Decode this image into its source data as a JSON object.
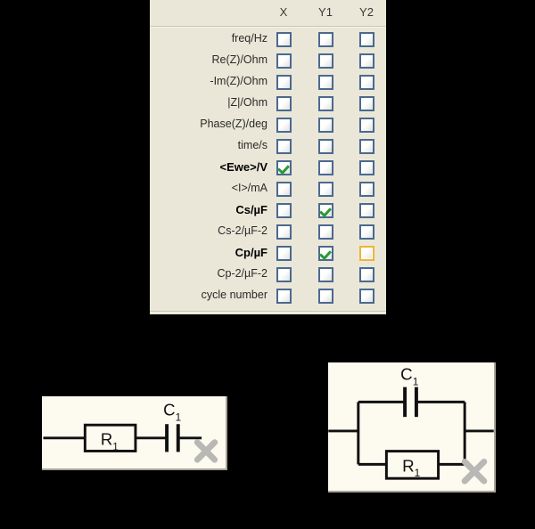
{
  "variable_panel": {
    "columns": [
      "X",
      "Y1",
      "Y2"
    ],
    "rows": [
      {
        "label": "freq/Hz",
        "bold": false,
        "x": false,
        "y1": false,
        "y2": false,
        "y2_focus": false
      },
      {
        "label": "Re(Z)/Ohm",
        "bold": false,
        "x": false,
        "y1": false,
        "y2": false,
        "y2_focus": false
      },
      {
        "label": "-Im(Z)/Ohm",
        "bold": false,
        "x": false,
        "y1": false,
        "y2": false,
        "y2_focus": false
      },
      {
        "label": "|Z|/Ohm",
        "bold": false,
        "x": false,
        "y1": false,
        "y2": false,
        "y2_focus": false
      },
      {
        "label": "Phase(Z)/deg",
        "bold": false,
        "x": false,
        "y1": false,
        "y2": false,
        "y2_focus": false
      },
      {
        "label": "time/s",
        "bold": false,
        "x": false,
        "y1": false,
        "y2": false,
        "y2_focus": false
      },
      {
        "label": "<Ewe>/V",
        "bold": true,
        "x": true,
        "y1": false,
        "y2": false,
        "y2_focus": false
      },
      {
        "label": "<I>/mA",
        "bold": false,
        "x": false,
        "y1": false,
        "y2": false,
        "y2_focus": false
      },
      {
        "label": "Cs/µF",
        "bold": true,
        "x": false,
        "y1": true,
        "y2": false,
        "y2_focus": false
      },
      {
        "label": "Cs-2/µF-2",
        "bold": false,
        "x": false,
        "y1": false,
        "y2": false,
        "y2_focus": false
      },
      {
        "label": "Cp/µF",
        "bold": true,
        "x": false,
        "y1": true,
        "y2": false,
        "y2_focus": true
      },
      {
        "label": "Cp-2/µF-2",
        "bold": false,
        "x": false,
        "y1": false,
        "y2": false,
        "y2_focus": false
      },
      {
        "label": "cycle number",
        "bold": false,
        "x": false,
        "y1": false,
        "y2": false,
        "y2_focus": false
      }
    ],
    "colors": {
      "panel_background": "#EAE7D8",
      "checkbox_border": "#4a6a90",
      "check_mark": "#2a9a38",
      "focus_highlight": "#f0b437"
    }
  },
  "circuits": [
    {
      "id": "series",
      "topology": "R1 in series with C1",
      "resistor_label": "R",
      "resistor_sub": "1",
      "capacitor_label": "C",
      "capacitor_sub": "1",
      "close_icon": "close-x-icon"
    },
    {
      "id": "parallel",
      "topology": "R1 in parallel with C1",
      "resistor_label": "R",
      "resistor_sub": "1",
      "capacitor_label": "C",
      "capacitor_sub": "1",
      "close_icon": "close-x-icon"
    }
  ]
}
